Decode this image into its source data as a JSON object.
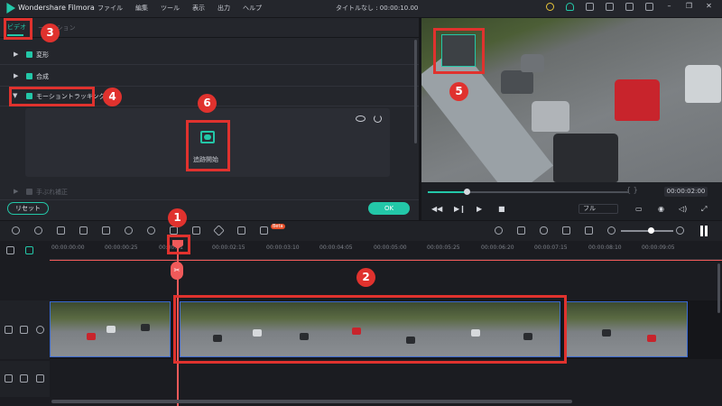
{
  "app": {
    "name": "Wondershare Filmora",
    "doc_title": "タイトルなし : 00:00:10.00"
  },
  "menu": [
    "ファイル",
    "編集",
    "ツール",
    "表示",
    "出力",
    "ヘルプ"
  ],
  "left_panel": {
    "tabs": {
      "video": "ビデオ",
      "animation": "ーメーション"
    },
    "rows": {
      "transform": "変形",
      "composite": "合成",
      "motion_tracking": "モーショントラッキング",
      "stabilize": "手ぶれ補正"
    },
    "tracking_button_label": "追跡開始",
    "reset_label": "リセット",
    "ok_label": "OK"
  },
  "preview": {
    "time": "00:00:02:00",
    "quality": "フル",
    "brackets": "{    }",
    "progress_fraction": 0.2
  },
  "timeline": {
    "ticks": [
      "00:00:00:00",
      "00:00:00:25",
      "00:00:01",
      "00:00:02:15",
      "00:00:03:10",
      "00:00:04:05",
      "00:00:05:00",
      "00:00:05:25",
      "00:00:06:20",
      "00:00:07:15",
      "00:00:08:10",
      "00:00:09:05"
    ],
    "beta_label": "Beta"
  },
  "callouts": [
    "1",
    "2",
    "3",
    "4",
    "5",
    "6"
  ],
  "colors": {
    "accent": "#23c7a8",
    "highlight": "#e0322e",
    "playhead": "#f05a5a"
  }
}
